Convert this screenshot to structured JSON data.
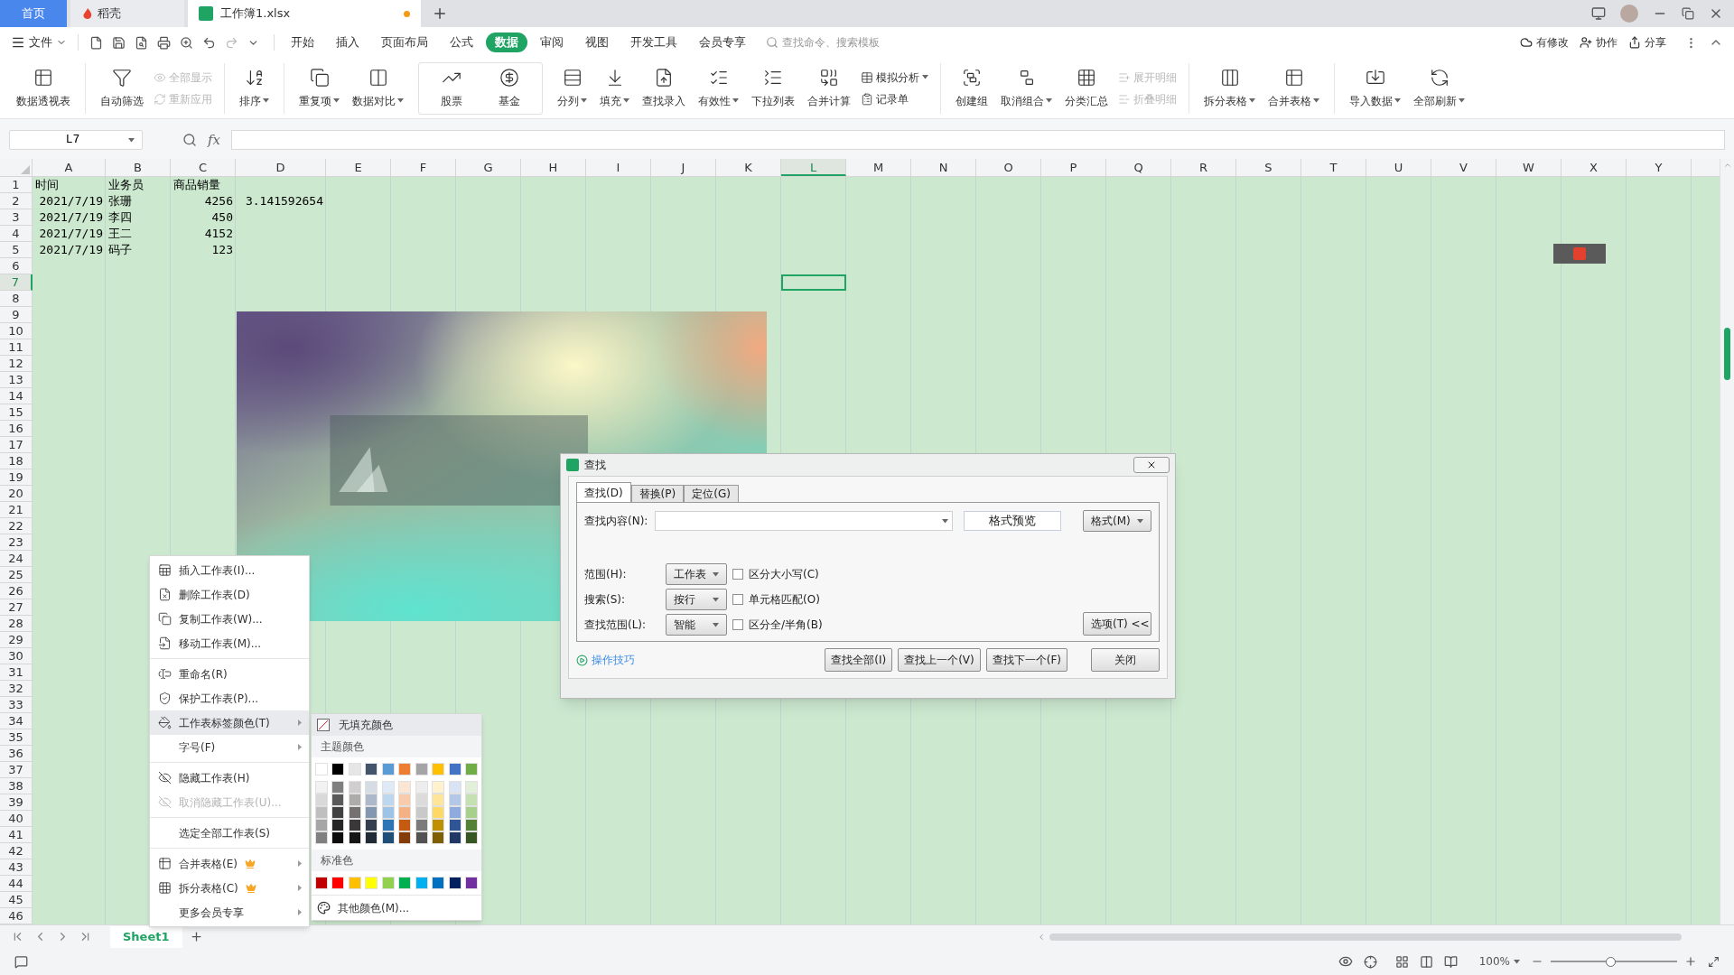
{
  "tab_bar": {
    "tabs": [
      {
        "label": "首页",
        "kind": "home",
        "selected": false,
        "modified": false
      },
      {
        "label": "稻壳",
        "kind": "docer",
        "selected": false,
        "modified": false
      },
      {
        "label": "工作簿1.xlsx",
        "kind": "sheet",
        "selected": true,
        "modified": true
      }
    ]
  },
  "menu_bar": {
    "file_menu": "文件",
    "tabs": [
      {
        "label": "开始",
        "selected": false
      },
      {
        "label": "插入",
        "selected": false
      },
      {
        "label": "页面布局",
        "selected": false
      },
      {
        "label": "公式",
        "selected": false
      },
      {
        "label": "数据",
        "selected": true
      },
      {
        "label": "审阅",
        "selected": false
      },
      {
        "label": "视图",
        "selected": false
      },
      {
        "label": "开发工具",
        "selected": false
      },
      {
        "label": "会员专享",
        "selected": false
      }
    ],
    "search": {
      "placeholder": "查找命令、搜索模板"
    },
    "actions": [
      "有修改",
      "协作",
      "分享"
    ]
  },
  "ribbon": {
    "groups": [
      {
        "boxed": false,
        "items": [
          {
            "label": "数据透视表",
            "kind": "large",
            "disabled": false,
            "dropdown": false
          }
        ]
      },
      {
        "boxed": false,
        "items": [
          {
            "label": "自动筛选",
            "kind": "large",
            "disabled": false,
            "dropdown": false
          },
          {
            "label": "全部显示",
            "kind": "small",
            "disabled": true,
            "dropdown": false
          },
          {
            "label": "重新应用",
            "kind": "small",
            "disabled": true,
            "dropdown": false
          }
        ]
      },
      {
        "boxed": false,
        "items": [
          {
            "label": "排序",
            "kind": "large",
            "disabled": false,
            "dropdown": true
          }
        ]
      },
      {
        "boxed": false,
        "items": [
          {
            "label": "重复项",
            "kind": "large",
            "disabled": false,
            "dropdown": true
          },
          {
            "label": "数据对比",
            "kind": "large",
            "disabled": false,
            "dropdown": true
          }
        ]
      },
      {
        "boxed": true,
        "items": [
          {
            "label": "股票",
            "kind": "large",
            "disabled": false,
            "dropdown": false
          },
          {
            "label": "基金",
            "kind": "large",
            "disabled": false,
            "dropdown": false
          }
        ]
      },
      {
        "boxed": false,
        "items": [
          {
            "label": "分列",
            "kind": "large",
            "disabled": false,
            "dropdown": true
          },
          {
            "label": "填充",
            "kind": "large",
            "disabled": false,
            "dropdown": true
          },
          {
            "label": "查找录入",
            "kind": "large",
            "disabled": false,
            "dropdown": false
          },
          {
            "label": "有效性",
            "kind": "large",
            "disabled": false,
            "dropdown": true
          },
          {
            "label": "下拉列表",
            "kind": "large",
            "disabled": false,
            "dropdown": false
          },
          {
            "label": "合并计算",
            "kind": "large",
            "disabled": false,
            "dropdown": false
          },
          {
            "label": "模拟分析",
            "kind": "small",
            "disabled": false,
            "dropdown": true
          },
          {
            "label": "记录单",
            "kind": "small",
            "disabled": false,
            "dropdown": false
          }
        ]
      },
      {
        "boxed": false,
        "items": [
          {
            "label": "创建组",
            "kind": "large",
            "disabled": false,
            "dropdown": false
          },
          {
            "label": "取消组合",
            "kind": "large",
            "disabled": false,
            "dropdown": true
          },
          {
            "label": "分类汇总",
            "kind": "large",
            "disabled": false,
            "dropdown": false
          },
          {
            "label": "展开明细",
            "kind": "small",
            "disabled": true,
            "dropdown": false
          },
          {
            "label": "折叠明细",
            "kind": "small",
            "disabled": true,
            "dropdown": false
          }
        ]
      },
      {
        "boxed": false,
        "items": [
          {
            "label": "拆分表格",
            "kind": "large",
            "disabled": false,
            "dropdown": true
          },
          {
            "label": "合并表格",
            "kind": "large",
            "disabled": false,
            "dropdown": true
          }
        ]
      },
      {
        "boxed": false,
        "items": [
          {
            "label": "导入数据",
            "kind": "large",
            "disabled": false,
            "dropdown": true
          },
          {
            "label": "全部刷新",
            "kind": "large",
            "disabled": false,
            "dropdown": true
          }
        ]
      }
    ]
  },
  "formula_bar": {
    "name_box": "L7",
    "function_label": "fx"
  },
  "sheet": {
    "columns": [
      {
        "label": "A",
        "selected": false
      },
      {
        "label": "B",
        "selected": false
      },
      {
        "label": "C",
        "selected": false
      },
      {
        "label": "D",
        "selected": false
      },
      {
        "label": "E",
        "selected": false
      },
      {
        "label": "F",
        "selected": false
      },
      {
        "label": "G",
        "selected": false
      },
      {
        "label": "H",
        "selected": false
      },
      {
        "label": "I",
        "selected": false
      },
      {
        "label": "J",
        "selected": false
      },
      {
        "label": "K",
        "selected": false
      },
      {
        "label": "L",
        "selected": true
      },
      {
        "label": "M",
        "selected": false
      },
      {
        "label": "N",
        "selected": false
      },
      {
        "label": "O",
        "selected": false
      },
      {
        "label": "P",
        "selected": false
      },
      {
        "label": "Q",
        "selected": false
      },
      {
        "label": "R",
        "selected": false
      },
      {
        "label": "S",
        "selected": false
      },
      {
        "label": "T",
        "selected": false
      },
      {
        "label": "U",
        "selected": false
      },
      {
        "label": "V",
        "selected": false
      },
      {
        "label": "W",
        "selected": false
      },
      {
        "label": "X",
        "selected": false
      },
      {
        "label": "Y",
        "selected": false
      }
    ],
    "row_headers": [
      {
        "label": "1",
        "selected": false
      },
      {
        "label": "2",
        "selected": false
      },
      {
        "label": "3",
        "selected": false
      },
      {
        "label": "4",
        "selected": false
      },
      {
        "label": "5",
        "selected": false
      },
      {
        "label": "6",
        "selected": false
      },
      {
        "label": "7",
        "selected": true
      },
      {
        "label": "8",
        "selected": false
      },
      {
        "label": "9",
        "selected": false
      },
      {
        "label": "10",
        "selected": false
      },
      {
        "label": "11",
        "selected": false
      },
      {
        "label": "12",
        "selected": false
      },
      {
        "label": "13",
        "selected": false
      },
      {
        "label": "14",
        "selected": false
      },
      {
        "label": "15",
        "selected": false
      },
      {
        "label": "16",
        "selected": false
      },
      {
        "label": "17",
        "selected": false
      },
      {
        "label": "18",
        "selected": false
      },
      {
        "label": "19",
        "selected": false
      },
      {
        "label": "20",
        "selected": false
      },
      {
        "label": "21",
        "selected": false
      },
      {
        "label": "22",
        "selected": false
      },
      {
        "label": "23",
        "selected": false
      },
      {
        "label": "24",
        "selected": false
      },
      {
        "label": "25",
        "selected": false
      },
      {
        "label": "26",
        "selected": false
      },
      {
        "label": "27",
        "selected": false
      },
      {
        "label": "28",
        "selected": false
      },
      {
        "label": "29",
        "selected": false
      },
      {
        "label": "30",
        "selected": false
      },
      {
        "label": "31",
        "selected": false
      },
      {
        "label": "32",
        "selected": false
      },
      {
        "label": "33",
        "selected": false
      },
      {
        "label": "34",
        "selected": false
      },
      {
        "label": "35",
        "selected": false
      },
      {
        "label": "36",
        "selected": false
      },
      {
        "label": "37",
        "selected": false
      },
      {
        "label": "38",
        "selected": false
      },
      {
        "label": "39",
        "selected": false
      },
      {
        "label": "40",
        "selected": false
      },
      {
        "label": "41",
        "selected": false
      },
      {
        "label": "42",
        "selected": false
      },
      {
        "label": "43",
        "selected": false
      },
      {
        "label": "44",
        "selected": false
      },
      {
        "label": "45",
        "selected": false
      },
      {
        "label": "46",
        "selected": false
      }
    ],
    "rows": [
      {
        "cells": [
          {
            "text": "时间",
            "kind": "text"
          },
          {
            "text": "业务员",
            "kind": "text"
          },
          {
            "text": "商品销量",
            "kind": "text"
          }
        ]
      },
      {
        "cells": [
          {
            "text": "2021/7/19",
            "kind": "number"
          },
          {
            "text": "张珊",
            "kind": "text"
          },
          {
            "text": "4256",
            "kind": "number"
          },
          {
            "text": "3.141592654",
            "kind": "number"
          }
        ]
      },
      {
        "cells": [
          {
            "text": "2021/7/19",
            "kind": "number"
          },
          {
            "text": "李四",
            "kind": "text"
          },
          {
            "text": "450",
            "kind": "number"
          }
        ]
      },
      {
        "cells": [
          {
            "text": "2021/7/19",
            "kind": "number"
          },
          {
            "text": "王二",
            "kind": "text"
          },
          {
            "text": "4152",
            "kind": "number"
          }
        ]
      },
      {
        "cells": [
          {
            "text": "2021/7/19",
            "kind": "number"
          },
          {
            "text": "码子",
            "kind": "text"
          },
          {
            "text": "123",
            "kind": "number"
          }
        ]
      }
    ]
  },
  "sheet_tabs": [
    {
      "label": "Sheet1",
      "selected": true
    }
  ],
  "status_bar": {
    "zoom": "100%",
    "zoom_slider": {
      "level": 0.47
    }
  },
  "context_menu": {
    "groups": [
      {
        "items": [
          {
            "label": "插入工作表(I)...",
            "icon": true,
            "disabled": false,
            "submenu": false,
            "premium": false,
            "selected": false
          },
          {
            "label": "删除工作表(D)",
            "icon": true,
            "disabled": false,
            "submenu": false,
            "premium": false,
            "selected": false
          },
          {
            "label": "复制工作表(W)...",
            "icon": true,
            "disabled": false,
            "submenu": false,
            "premium": false,
            "selected": false
          },
          {
            "label": "移动工作表(M)...",
            "icon": true,
            "disabled": false,
            "submenu": false,
            "premium": false,
            "selected": false
          }
        ]
      },
      {
        "items": [
          {
            "label": "重命名(R)",
            "icon": true,
            "disabled": false,
            "submenu": false,
            "premium": false,
            "selected": false
          },
          {
            "label": "保护工作表(P)...",
            "icon": true,
            "disabled": false,
            "submenu": false,
            "premium": false,
            "selected": false
          },
          {
            "label": "工作表标签颜色(T)",
            "icon": true,
            "disabled": false,
            "submenu": true,
            "premium": false,
            "selected": true
          },
          {
            "label": "字号(F)",
            "icon": false,
            "disabled": false,
            "submenu": true,
            "premium": false,
            "selected": false
          }
        ]
      },
      {
        "items": [
          {
            "label": "隐藏工作表(H)",
            "icon": true,
            "disabled": false,
            "submenu": false,
            "premium": false,
            "selected": false
          },
          {
            "label": "取消隐藏工作表(U)...",
            "icon": true,
            "disabled": true,
            "submenu": false,
            "premium": false,
            "selected": false
          }
        ]
      },
      {
        "items": [
          {
            "label": "选定全部工作表(S)",
            "icon": false,
            "disabled": false,
            "submenu": false,
            "premium": false,
            "selected": false
          }
        ]
      },
      {
        "items": [
          {
            "label": "合并表格(E)",
            "icon": true,
            "disabled": false,
            "submenu": true,
            "premium": true,
            "selected": false
          },
          {
            "label": "拆分表格(C)",
            "icon": true,
            "disabled": false,
            "submenu": true,
            "premium": true,
            "selected": false
          },
          {
            "label": "更多会员专享",
            "icon": false,
            "disabled": false,
            "submenu": true,
            "premium": false,
            "selected": false
          }
        ]
      }
    ]
  },
  "color_submenu": {
    "no_fill": {
      "label": "无填充颜色",
      "selected": true
    },
    "theme_title": "主题颜色",
    "theme_colors": [
      {
        "color": "#ffffff"
      },
      {
        "color": "#000000"
      },
      {
        "color": "#e7e6e6"
      },
      {
        "color": "#44546a"
      },
      {
        "color": "#5b9bd5"
      },
      {
        "color": "#ed7d31"
      },
      {
        "color": "#a5a5a5"
      },
      {
        "color": "#ffc000"
      },
      {
        "color": "#4472c4"
      },
      {
        "color": "#70ad47"
      }
    ],
    "theme_shades": [
      [
        {
          "color": "#f2f2f2"
        },
        {
          "color": "#7f7f7f"
        },
        {
          "color": "#d0cece"
        },
        {
          "color": "#d6dce4"
        },
        {
          "color": "#deebf6"
        },
        {
          "color": "#fbe5d5"
        },
        {
          "color": "#ededed"
        },
        {
          "color": "#fff2cc"
        },
        {
          "color": "#dae3f3"
        },
        {
          "color": "#e2efd9"
        }
      ],
      [
        {
          "color": "#d9d9d9"
        },
        {
          "color": "#595959"
        },
        {
          "color": "#aeabab"
        },
        {
          "color": "#adb9ca"
        },
        {
          "color": "#bdd7ee"
        },
        {
          "color": "#f7cbac"
        },
        {
          "color": "#dbdbdb"
        },
        {
          "color": "#fee599"
        },
        {
          "color": "#b4c7e7"
        },
        {
          "color": "#c5e0b3"
        }
      ],
      [
        {
          "color": "#bfbfbf"
        },
        {
          "color": "#404040"
        },
        {
          "color": "#757171"
        },
        {
          "color": "#8497b0"
        },
        {
          "color": "#9dc3e6"
        },
        {
          "color": "#f4b183"
        },
        {
          "color": "#c9c9c9"
        },
        {
          "color": "#ffd965"
        },
        {
          "color": "#8faadc"
        },
        {
          "color": "#a8d08d"
        }
      ],
      [
        {
          "color": "#a6a6a6"
        },
        {
          "color": "#262626"
        },
        {
          "color": "#3a3838"
        },
        {
          "color": "#333f4f"
        },
        {
          "color": "#2e75b5"
        },
        {
          "color": "#c55a11"
        },
        {
          "color": "#7b7b7b"
        },
        {
          "color": "#bf9000"
        },
        {
          "color": "#2f5597"
        },
        {
          "color": "#538135"
        }
      ],
      [
        {
          "color": "#808080"
        },
        {
          "color": "#0d0d0d"
        },
        {
          "color": "#171616"
        },
        {
          "color": "#222a35"
        },
        {
          "color": "#1f4e79"
        },
        {
          "color": "#843c0b"
        },
        {
          "color": "#525252"
        },
        {
          "color": "#7f6000"
        },
        {
          "color": "#1f3864"
        },
        {
          "color": "#375623"
        }
      ]
    ],
    "standard_title": "标准色",
    "standard_colors": [
      {
        "color": "#c00000"
      },
      {
        "color": "#ff0000"
      },
      {
        "color": "#ffc000"
      },
      {
        "color": "#ffff00"
      },
      {
        "color": "#92d050"
      },
      {
        "color": "#00b050"
      },
      {
        "color": "#00b0f0"
      },
      {
        "color": "#0070c0"
      },
      {
        "color": "#002060"
      },
      {
        "color": "#7030a0"
      }
    ],
    "more_colors": "其他颜色(M)..."
  },
  "find_dialog": {
    "title": "查找",
    "tabs": [
      {
        "label": "查找(D)",
        "selected": true
      },
      {
        "label": "替换(P)",
        "selected": false
      },
      {
        "label": "定位(G)",
        "selected": false
      }
    ],
    "find_label": "查找内容(N):",
    "format_preview": "格式预览",
    "format_button": "格式(M)",
    "options": [
      {
        "label": "范围(H):",
        "value": "工作表",
        "checkbox": {
          "label": "区分大小写(C)",
          "checked": false
        }
      },
      {
        "label": "搜索(S):",
        "value": "按行",
        "checkbox": {
          "label": "单元格匹配(O)",
          "checked": false
        }
      },
      {
        "label": "查找范围(L):",
        "value": "智能",
        "checkbox": {
          "label": "区分全/半角(B)",
          "checked": false
        }
      }
    ],
    "options_button": "选项(T) <<",
    "tips_link": "操作技巧",
    "buttons": [
      "查找全部(I)",
      "查找上一个(V)",
      "查找下一个(F)"
    ],
    "close_button": "关闭"
  }
}
